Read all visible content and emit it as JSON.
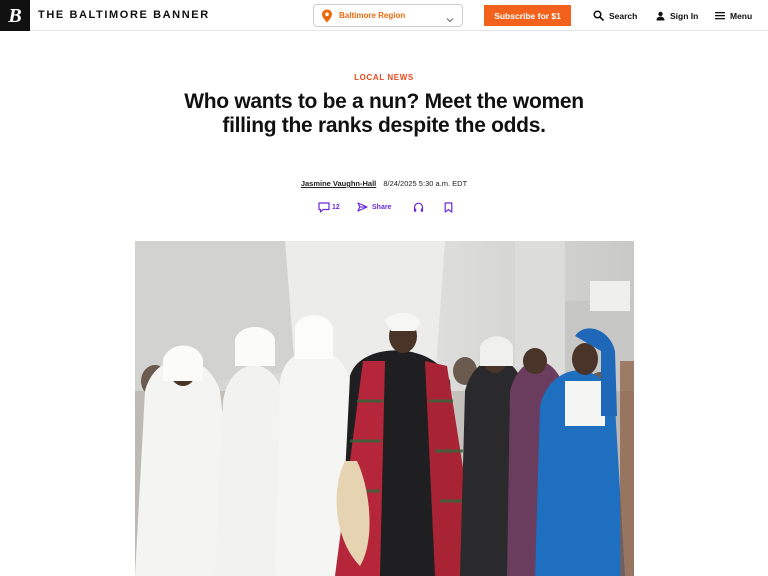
{
  "header": {
    "logo_letter": "B",
    "brand_name": "THE BALTIMORE BANNER",
    "region_selector": {
      "label": "Baltimore Region",
      "icon": "location-pin-icon"
    },
    "subscribe_label": "Subscribe for $1",
    "search_label": "Search",
    "signin_label": "Sign In",
    "menu_label": "Menu"
  },
  "article": {
    "kicker": "LOCAL NEWS",
    "headline": "Who wants to be a nun? Meet the women filling the ranks despite the odds.",
    "author": "Jasmine Vaughn-Hall",
    "timestamp": "8/24/2025 5:30 a.m. EDT",
    "actions": {
      "comments_count": "12",
      "share_label": "Share",
      "listen_icon": "headphones-icon",
      "save_icon": "bookmark-icon"
    }
  },
  "colors": {
    "brand_orange": "#f3621c",
    "kicker_red": "#e8491d",
    "action_purple": "#6a2bd9"
  }
}
